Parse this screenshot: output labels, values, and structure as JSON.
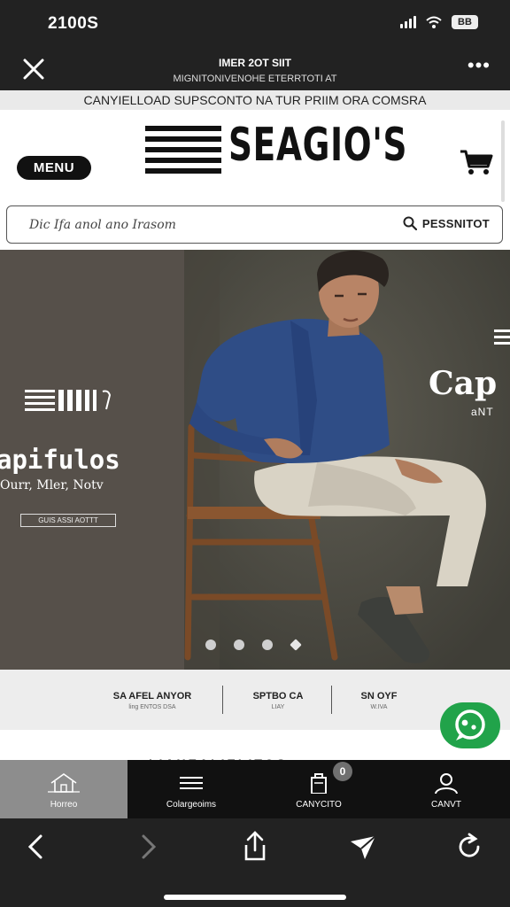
{
  "status": {
    "time": "2100S",
    "battery": "BB"
  },
  "browser": {
    "title": "IMER 2OT SIIT",
    "url": "MIGNITONIVENOHE ETERRTOTI AT"
  },
  "promo": {
    "text": "CANYIELLOAD SUPSCONTO NA TUR PRIIM ORA COMSRA"
  },
  "header": {
    "menu_label": "MENU",
    "logo_text": "SEAGIO'S"
  },
  "search": {
    "placeholder": "Dic Ifa anol ano Irasom",
    "action_label": "PESSNITOT"
  },
  "hero": {
    "title": "apifulos",
    "subtitle": "Ourr, Mler, Notv",
    "cta": "GUIS ASSI AOTTT",
    "title_right": "Cap",
    "subtitle_right": "aNT",
    "slides": 4,
    "active_slide": 4
  },
  "categories": [
    {
      "title": "SA AFEL ANYOR",
      "sub": "ling ENTOS DSA"
    },
    {
      "title": "SPTBO CA",
      "sub": "LIAY"
    },
    {
      "title": "SN OYF",
      "sub": "W.IVA"
    }
  ],
  "section": {
    "heading": "LIAHEALIELITOS"
  },
  "tabs": [
    {
      "label": "Horreo",
      "icon": "home-icon",
      "active": true
    },
    {
      "label": "Colargeoims",
      "icon": "menu-lines-icon",
      "active": false
    },
    {
      "label": "CANYCITO",
      "icon": "cart-bag-icon",
      "active": false,
      "badge": "0"
    },
    {
      "label": "CANVT",
      "icon": "user-icon",
      "active": false
    }
  ],
  "colors": {
    "accent_green": "#21a34a",
    "dark": "#111111",
    "hero_bg": "#56504a"
  }
}
